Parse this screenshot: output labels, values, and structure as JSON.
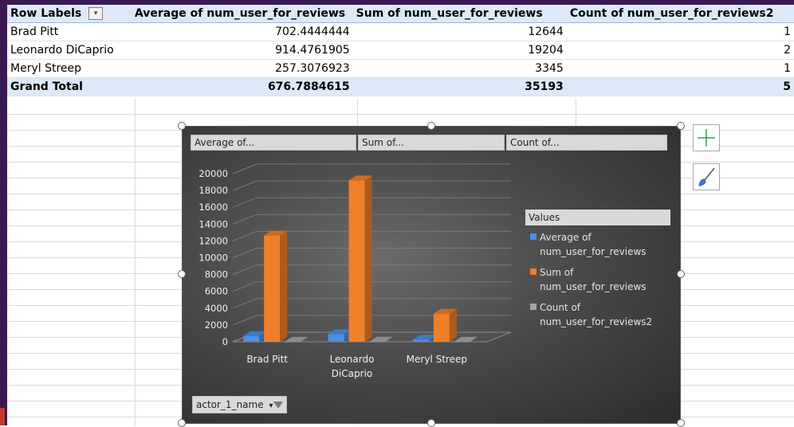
{
  "pivot": {
    "headers": [
      "Row Labels",
      "Average of num_user_for_reviews",
      "Sum of num_user_for_reviews",
      "Count of num_user_for_reviews2"
    ],
    "rows": [
      {
        "label": "Brad Pitt",
        "avg": "702.4444444",
        "sum": "12644",
        "count": "1"
      },
      {
        "label": "Leonardo DiCaprio",
        "avg": "914.4761905",
        "sum": "19204",
        "count": "2"
      },
      {
        "label": "Meryl Streep",
        "avg": "257.3076923",
        "sum": "3345",
        "count": "1"
      }
    ],
    "total": {
      "label": "Grand Total",
      "avg": "676.7884615",
      "sum": "35193",
      "count": "5"
    }
  },
  "chart": {
    "field_buttons": [
      "Average of...",
      "Sum of...",
      "Count of..."
    ],
    "legend_title": "Values",
    "legend": [
      {
        "line1": "Average of",
        "line2": "num_user_for_reviews",
        "color": "#4a90e2"
      },
      {
        "line1": "Sum of",
        "line2": "num_user_for_reviews",
        "color": "#f07f2a"
      },
      {
        "line1": "Count of",
        "line2": "num_user_for_reviews2",
        "color": "#a6a6a6"
      }
    ],
    "axis_field_label": "actor_1_name"
  },
  "chart_data": {
    "type": "bar",
    "categories": [
      "Brad Pitt",
      "Leonardo DiCaprio",
      "Meryl Streep"
    ],
    "category_lines": [
      [
        "Brad Pitt"
      ],
      [
        "Leonardo",
        "DiCaprio"
      ],
      [
        "Meryl Streep"
      ]
    ],
    "series": [
      {
        "name": "Average of num_user_for_reviews",
        "values": [
          702.4444444,
          914.4761905,
          257.3076923
        ],
        "color": "#4a90e2"
      },
      {
        "name": "Sum of num_user_for_reviews",
        "values": [
          12644,
          19204,
          3345
        ],
        "color": "#f07f2a"
      },
      {
        "name": "Count of num_user_for_reviews2",
        "values": [
          9,
          21,
          13
        ],
        "color": "#a6a6a6"
      }
    ],
    "yticks": [
      "0",
      "2000",
      "4000",
      "6000",
      "8000",
      "10000",
      "12000",
      "14000",
      "16000",
      "18000",
      "20000"
    ],
    "ylim": [
      0,
      20000
    ],
    "grid": true
  }
}
